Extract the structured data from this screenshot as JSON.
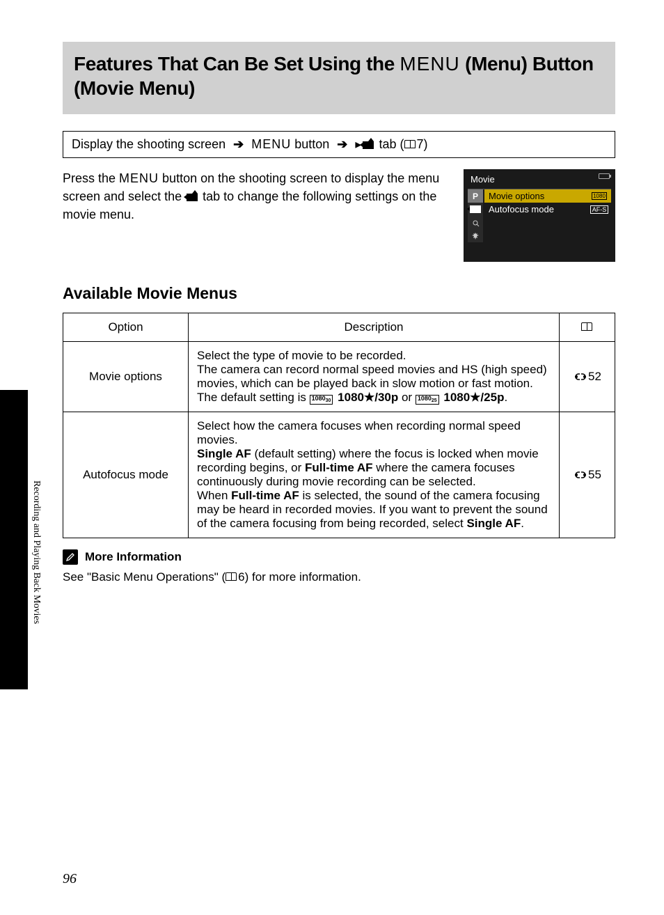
{
  "title_part1": "Features That Can Be Set Using the ",
  "title_menu": "MENU",
  "title_part2": " (Menu) Button (Movie Menu)",
  "nav": {
    "step1": "Display the shooting screen ",
    "step2_menu": "MENU",
    "step2_rest": " button ",
    "step3": " tab (",
    "ref": "7",
    "close": ")"
  },
  "intro": {
    "line1a": "Press the ",
    "line1_menu": "MENU",
    "line1b": " button on the shooting screen to display the menu screen and select the ",
    "line1c": " tab to change the following settings on the movie menu."
  },
  "lcd": {
    "title": "Movie",
    "rows": [
      {
        "tab": "P",
        "label": "Movie options",
        "right": "1080/30"
      },
      {
        "tab": "🎥",
        "label": "Autofocus mode",
        "right": "AF-S"
      }
    ]
  },
  "section_heading": "Available Movie Menus",
  "table": {
    "headers": [
      "Option",
      "Description",
      ""
    ],
    "rows": [
      {
        "option": "Movie options",
        "desc_lines": [
          "Select the type of movie to be recorded.",
          "The camera can record normal speed movies and HS (high speed) movies, which can be played back in slow motion or fast motion.",
          "The default setting is "
        ],
        "default1": "1080★/30p",
        "or": " or ",
        "default2": "1080★/25p",
        "period": ".",
        "ref": "52"
      },
      {
        "option": "Autofocus mode",
        "desc_p1": "Select how the camera focuses when recording normal speed movies.",
        "desc_p2a": "Single AF",
        "desc_p2b": " (default setting) where the focus is locked when movie recording begins, or ",
        "desc_p2c": "Full-time AF",
        "desc_p2d": " where the camera focuses continuously during movie recording can be selected.",
        "desc_p3a": "When ",
        "desc_p3b": "Full-time AF",
        "desc_p3c": " is selected, the sound of the camera focusing may be heard in recorded movies. If you want to prevent the sound of the camera focusing from being recorded, select ",
        "desc_p3d": "Single AF",
        "desc_p3e": ".",
        "ref": "55"
      }
    ]
  },
  "more_info_label": "More Information",
  "more_info_text_a": "See \"Basic Menu Operations\" (",
  "more_info_ref": "6",
  "more_info_text_b": ") for more information.",
  "side_label": "Recording and Playing Back Movies",
  "page_number": "96"
}
